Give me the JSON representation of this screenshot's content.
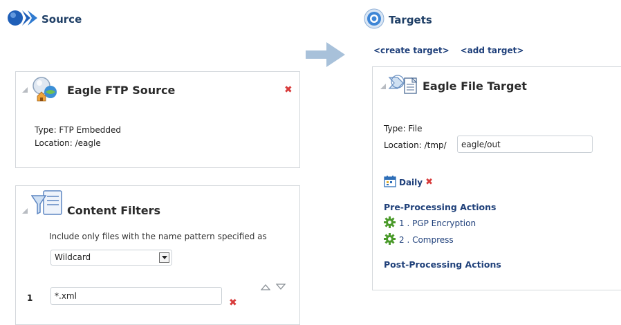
{
  "source": {
    "title": "Source",
    "panel": {
      "title": "Eagle FTP Source",
      "type_line": "Type: FTP Embedded",
      "location_line": "Location: /eagle"
    }
  },
  "filters": {
    "title": "Content Filters",
    "description": "Include only files with the name pattern specified as",
    "mode": "Wildcard",
    "rows": [
      {
        "index": "1",
        "pattern": "*.xml"
      }
    ]
  },
  "targets": {
    "title": "Targets",
    "create_link": "<create target>",
    "add_link": "<add target>",
    "panel": {
      "title": "Eagle File Target",
      "type_line": "Type: File",
      "location_label": "Location: /tmp/",
      "location_value": "eagle/out",
      "schedule": "Daily",
      "pre_heading": "Pre-Processing Actions",
      "pre_actions": [
        {
          "label": "1 . PGP Encryption"
        },
        {
          "label": "2 . Compress"
        }
      ],
      "post_heading": "Post-Processing Actions"
    }
  },
  "colors": {
    "accent_blue": "#1e3f7a",
    "arrow": "#9db8d4",
    "delete_red": "#d83b3b",
    "gear_green": "#4a9a2a"
  }
}
